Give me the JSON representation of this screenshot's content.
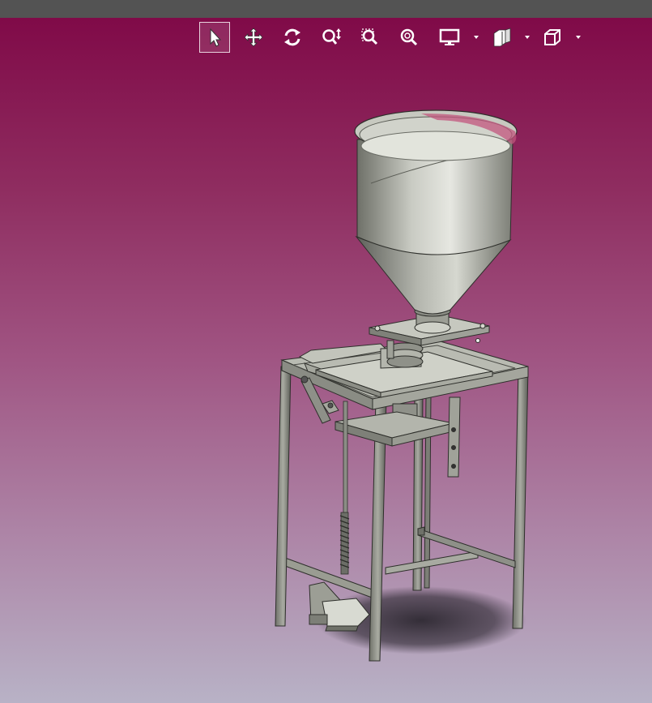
{
  "app": {
    "title": ""
  },
  "toolbar": {
    "tools": [
      {
        "id": "select",
        "icon": "select-arrow-icon",
        "active": true
      },
      {
        "id": "pan",
        "icon": "pan-move-icon",
        "active": false
      },
      {
        "id": "rotate",
        "icon": "rotate-view-icon",
        "active": false
      },
      {
        "id": "zoom-dynamic",
        "icon": "zoom-dynamic-icon",
        "active": false
      },
      {
        "id": "zoom-window",
        "icon": "zoom-window-icon",
        "active": false
      },
      {
        "id": "zoom-fit",
        "icon": "zoom-fit-icon",
        "active": false
      },
      {
        "id": "display-style",
        "icon": "display-monitor-icon",
        "dropdown": true
      },
      {
        "id": "section-view",
        "icon": "section-view-icon",
        "dropdown": true
      },
      {
        "id": "view-orientation",
        "icon": "cube-view-icon",
        "dropdown": true
      }
    ]
  },
  "colors": {
    "topbar": "#535353",
    "viewport_top": "#800a48",
    "viewport_bottom": "#b8b2c6",
    "model_steel": "#9a9c92",
    "model_dark": "#3a3b36"
  },
  "model": {
    "description_visible": false
  }
}
